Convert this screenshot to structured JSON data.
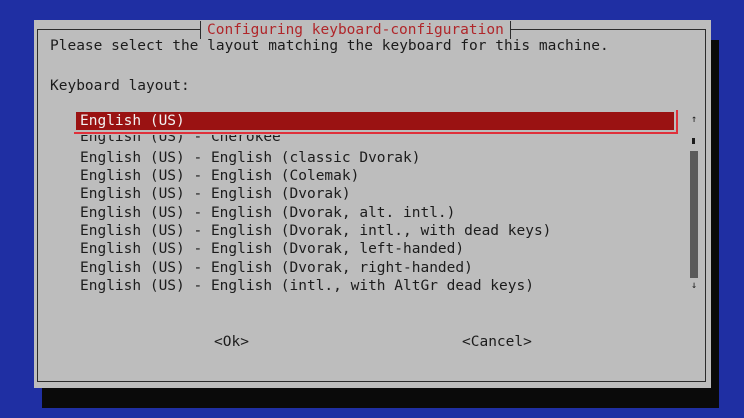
{
  "dialog": {
    "title": "Configuring keyboard-configuration",
    "prompt": "Please select the layout matching the keyboard for this machine.",
    "field_label": "Keyboard layout:"
  },
  "layouts": {
    "selected": "English (US)",
    "items": [
      "English (US) - Cherokee",
      "English (US) - English (classic Dvorak)",
      "English (US) - English (Colemak)",
      "English (US) - English (Dvorak)",
      "English (US) - English (Dvorak, alt. intl.)",
      "English (US) - English (Dvorak, intl., with dead keys)",
      "English (US) - English (Dvorak, left-handed)",
      "English (US) - English (Dvorak, right-handed)",
      "English (US) - English (intl., with AltGr dead keys)"
    ]
  },
  "scrollbar": {
    "up_arrow": "↑",
    "down_arrow": "↓"
  },
  "buttons": {
    "ok": "<Ok>",
    "cancel": "<Cancel>"
  },
  "colors": {
    "background": "#1f2fa3",
    "dialog": "#bdbdbd",
    "selection": "#9a1212",
    "title": "#b0262a"
  }
}
